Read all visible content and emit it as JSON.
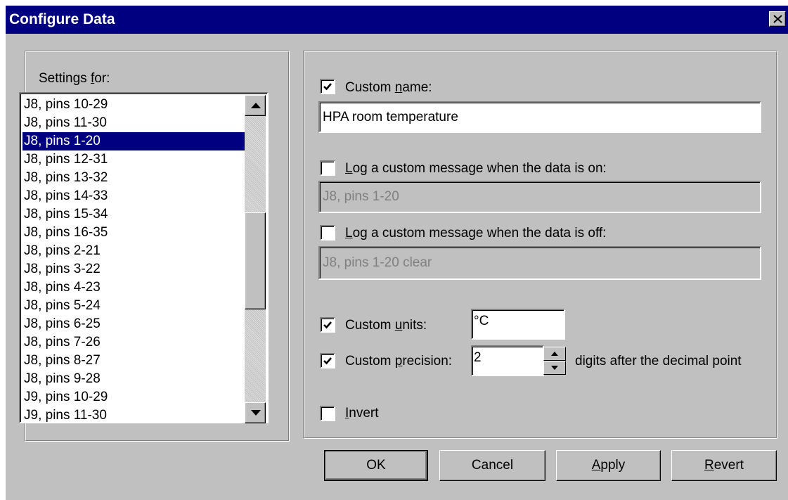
{
  "window": {
    "title": "Configure Data"
  },
  "settings": {
    "label_pre": "Settings ",
    "label_key": "f",
    "label_post": "or:",
    "items": [
      "J8, pins 10-29",
      "J8, pins 11-30",
      "J8, pins 1-20",
      "J8, pins 12-31",
      "J8, pins 13-32",
      "J8, pins 14-33",
      "J8, pins 15-34",
      "J8, pins 16-35",
      "J8, pins 2-21",
      "J8, pins 3-22",
      "J8, pins 4-23",
      "J8, pins 5-24",
      "J8, pins 6-25",
      "J8, pins 7-26",
      "J8, pins 8-27",
      "J8, pins 9-28",
      "J9, pins 10-29",
      "J9, pins 11-30"
    ],
    "selected_index": 2
  },
  "custom_name": {
    "checked": true,
    "label_pre": "Custom ",
    "label_key": "n",
    "label_post": "ame:",
    "value": "HPA room temperature"
  },
  "log_on": {
    "checked": false,
    "label_key": "L",
    "label_post": "og a custom message when the data is on:",
    "value": "J8, pins 1-20"
  },
  "log_off": {
    "checked": false,
    "label_key": "L",
    "label_post": "og a custom message when the data is off:",
    "value": "J8, pins 1-20 clear"
  },
  "units": {
    "checked": true,
    "label_pre": "Custom ",
    "label_key": "u",
    "label_post": "nits:",
    "value": "°C"
  },
  "precision": {
    "checked": true,
    "label_pre": "Custom ",
    "label_key": "p",
    "label_post": "recision:",
    "value": "2",
    "suffix": "digits after the decimal point"
  },
  "invert": {
    "checked": false,
    "label_key": "I",
    "label_post": "nvert"
  },
  "buttons": {
    "ok": "OK",
    "cancel": "Cancel",
    "apply_key": "A",
    "apply_post": "pply",
    "revert_key": "R",
    "revert_post": "evert"
  },
  "icons": [
    "close-icon",
    "scroll-up-arrow-icon",
    "scroll-down-arrow-icon",
    "checkmark-icon",
    "spin-up-arrow-icon",
    "spin-down-arrow-icon"
  ]
}
